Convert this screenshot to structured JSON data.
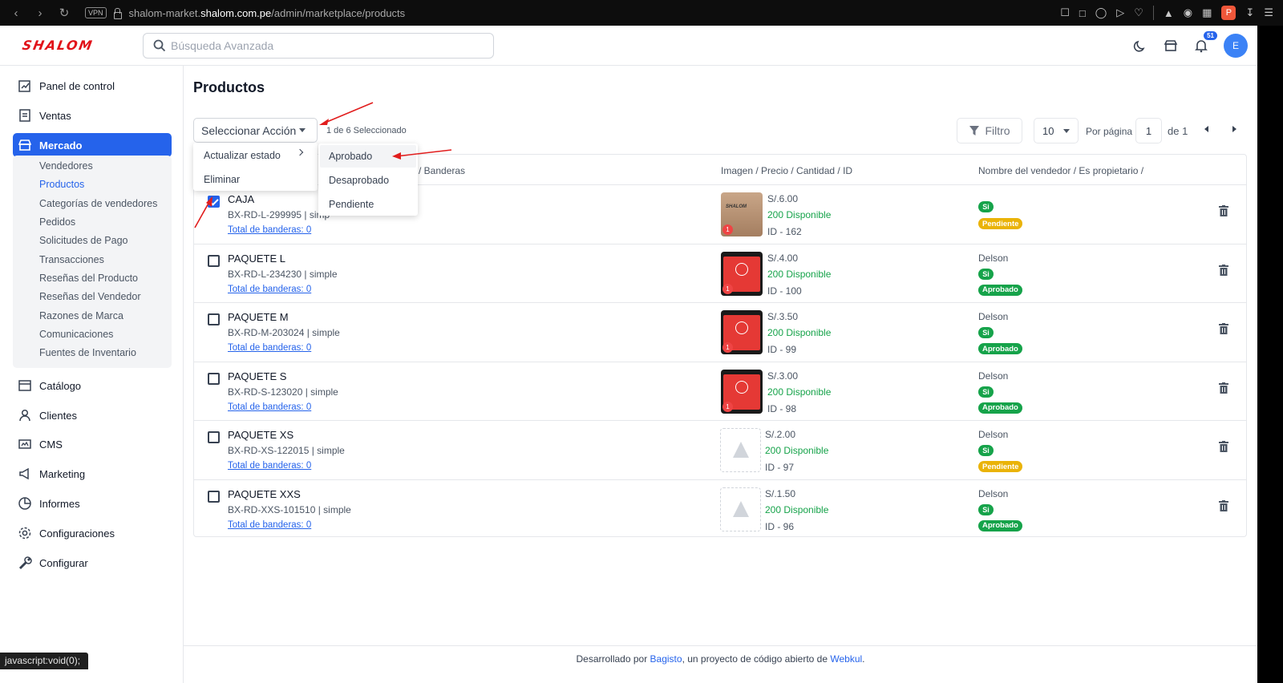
{
  "browser": {
    "vpn": "VPN",
    "url_prefix": "shalom-market.",
    "url_domain": "shalom.com.pe",
    "url_path": "/admin/marketplace/products",
    "profile_letter": "P"
  },
  "header": {
    "logo": "SHALOM",
    "search_placeholder": "Búsqueda Avanzada",
    "notifications_count": "51",
    "avatar_letter": "E"
  },
  "sidebar": {
    "items": [
      {
        "label": "Panel de control",
        "icon": "dashboard-icon"
      },
      {
        "label": "Ventas",
        "icon": "sales-icon"
      },
      {
        "label": "Mercado",
        "icon": "store-icon",
        "active": true
      },
      {
        "label": "Catálogo",
        "icon": "catalog-icon"
      },
      {
        "label": "Clientes",
        "icon": "customers-icon"
      },
      {
        "label": "CMS",
        "icon": "cms-icon"
      },
      {
        "label": "Marketing",
        "icon": "marketing-icon"
      },
      {
        "label": "Informes",
        "icon": "reports-icon"
      },
      {
        "label": "Configuraciones",
        "icon": "settings-icon"
      },
      {
        "label": "Configurar",
        "icon": "wrench-icon"
      }
    ],
    "sub_items": [
      "Vendedores",
      "Productos",
      "Categorías de vendedores",
      "Pedidos",
      "Solicitudes de Pago",
      "Transacciones",
      "Reseñas del Producto",
      "Reseñas del Vendedor",
      "Razones de Marca",
      "Comunicaciones",
      "Fuentes de Inventario"
    ]
  },
  "main": {
    "title": "Productos",
    "action_select": "Seleccionar Acción",
    "selected_count": "1 de 6 Seleccionado",
    "filter_label": "Filtro",
    "per_page_value": "10",
    "per_page_label": "Por página",
    "page_value": "1",
    "page_of": "de 1",
    "columns": [
      "o / Banderas",
      "Imagen / Precio / Cantidad / ID",
      "Nombre del vendedor / Es propietario /"
    ],
    "action_menu": [
      "Actualizar estado",
      "Eliminar"
    ],
    "status_menu": [
      "Aprobado",
      "Desaprobado",
      "Pendiente"
    ],
    "rows": [
      {
        "name": "CAJA",
        "sku": "BX-RD-L-299995 | simp",
        "flags": "Total de banderas: 0",
        "price": "S/.6.00",
        "stock": "200 Disponible",
        "id": "ID - 162",
        "vendor": "",
        "owner": "Si",
        "status": "Pendiente",
        "checked": true,
        "img": "box",
        "img_count": "1"
      },
      {
        "name": "PAQUETE L",
        "sku": "BX-RD-L-234230 | simple",
        "flags": "Total de banderas: 0",
        "price": "S/.4.00",
        "stock": "200 Disponible",
        "id": "ID - 100",
        "vendor": "Delson",
        "owner": "Si",
        "status": "Aprobado",
        "checked": false,
        "img": "red",
        "img_count": "1"
      },
      {
        "name": "PAQUETE M",
        "sku": "BX-RD-M-203024 | simple",
        "flags": "Total de banderas: 0",
        "price": "S/.3.50",
        "stock": "200 Disponible",
        "id": "ID - 99",
        "vendor": "Delson",
        "owner": "Si",
        "status": "Aprobado",
        "checked": false,
        "img": "red",
        "img_count": "1"
      },
      {
        "name": "PAQUETE S",
        "sku": "BX-RD-S-123020 | simple",
        "flags": "Total de banderas: 0",
        "price": "S/.3.00",
        "stock": "200 Disponible",
        "id": "ID - 98",
        "vendor": "Delson",
        "owner": "Si",
        "status": "Aprobado",
        "checked": false,
        "img": "red",
        "img_count": "1"
      },
      {
        "name": "PAQUETE XS",
        "sku": "BX-RD-XS-122015 | simple",
        "flags": "Total de banderas: 0",
        "price": "S/.2.00",
        "stock": "200 Disponible",
        "id": "ID - 97",
        "vendor": "Delson",
        "owner": "Si",
        "status": "Pendiente",
        "checked": false,
        "img": "placeholder",
        "img_count": ""
      },
      {
        "name": "PAQUETE XXS",
        "sku": "BX-RD-XXS-101510 | simple",
        "flags": "Total de banderas: 0",
        "price": "S/.1.50",
        "stock": "200 Disponible",
        "id": "ID - 96",
        "vendor": "Delson",
        "owner": "Si",
        "status": "Aprobado",
        "checked": false,
        "img": "placeholder",
        "img_count": ""
      }
    ]
  },
  "footer": {
    "prefix": "Desarrollado por ",
    "bagisto": "Bagisto",
    "middle": ", un proyecto de código abierto de ",
    "webkul": "Webkul",
    "suffix": "."
  },
  "status_bar": "javascript:void(0);",
  "colors": {
    "primary": "#2563eb",
    "brand_red": "#e1131a",
    "approved": "#16a34a",
    "pending": "#eab308",
    "annotation": "#e11d1d"
  }
}
